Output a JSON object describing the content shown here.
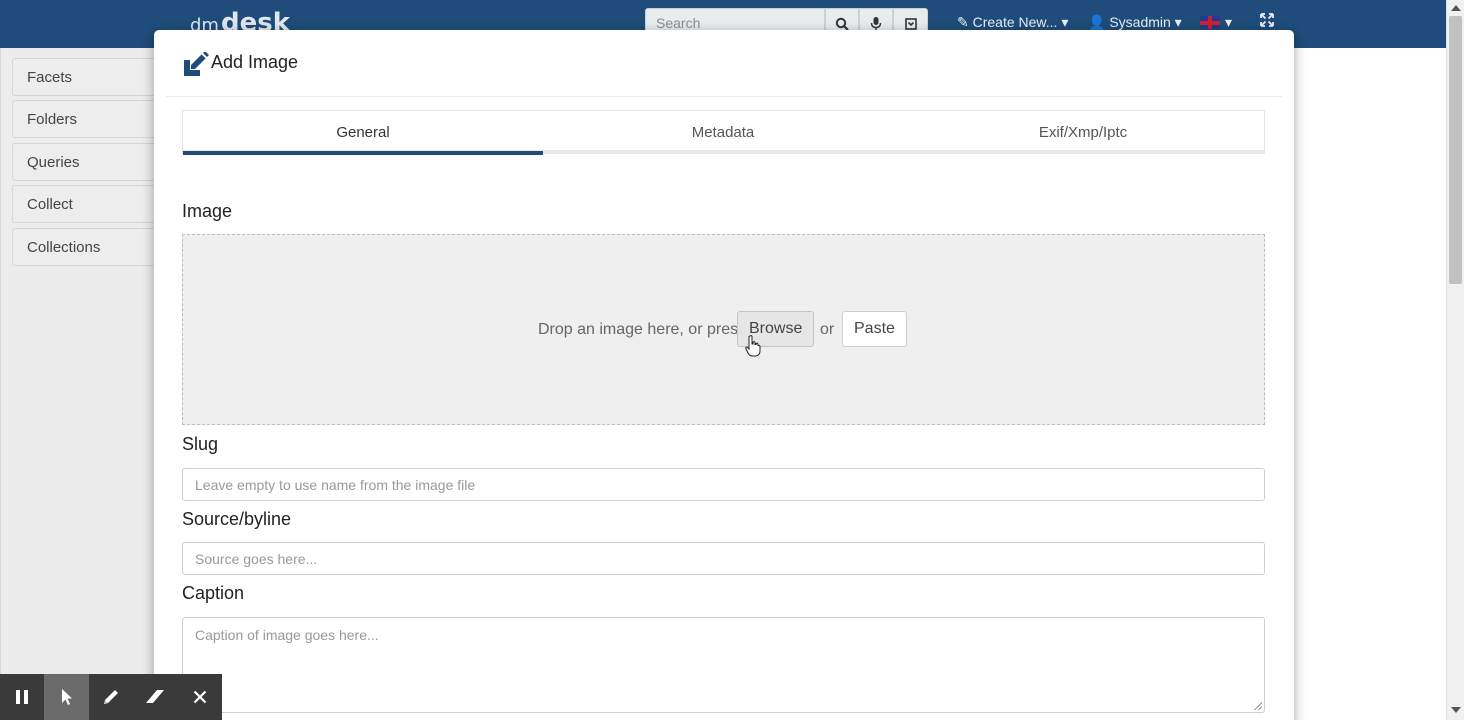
{
  "navbar": {
    "logo_prefix": "dm",
    "logo_main": "desk",
    "search_placeholder": "Search",
    "create_new": "✎ Create New... ▾",
    "user": "👤 Sysadmin ▾",
    "language_caret": "▾",
    "bg_color": "#1f4c7a"
  },
  "sidebar": {
    "items": [
      {
        "label": "Facets"
      },
      {
        "label": "Folders"
      },
      {
        "label": "Queries"
      },
      {
        "label": "Collect"
      },
      {
        "label": "Collections"
      }
    ]
  },
  "modal": {
    "title": "Add Image",
    "tabs": [
      {
        "label": "General",
        "active": true
      },
      {
        "label": "Metadata",
        "active": false
      },
      {
        "label": "Exif/Xmp/Iptc",
        "active": false
      }
    ],
    "image_label": "Image",
    "dropzone": {
      "text": "Drop an image here, or press",
      "browse": "Browse",
      "or": "or",
      "paste": "Paste"
    },
    "slug_label": "Slug",
    "slug_placeholder": "Leave empty to use name from the image file",
    "source_label": "Source/byline",
    "source_placeholder": "Source goes here...",
    "caption_label": "Caption",
    "caption_placeholder": "Caption of image goes here..."
  },
  "toolbar": {
    "icons": [
      "pause-icon",
      "cursor-icon",
      "pencil-icon",
      "eraser-icon",
      "close-icon"
    ],
    "selected": "cursor-icon"
  }
}
